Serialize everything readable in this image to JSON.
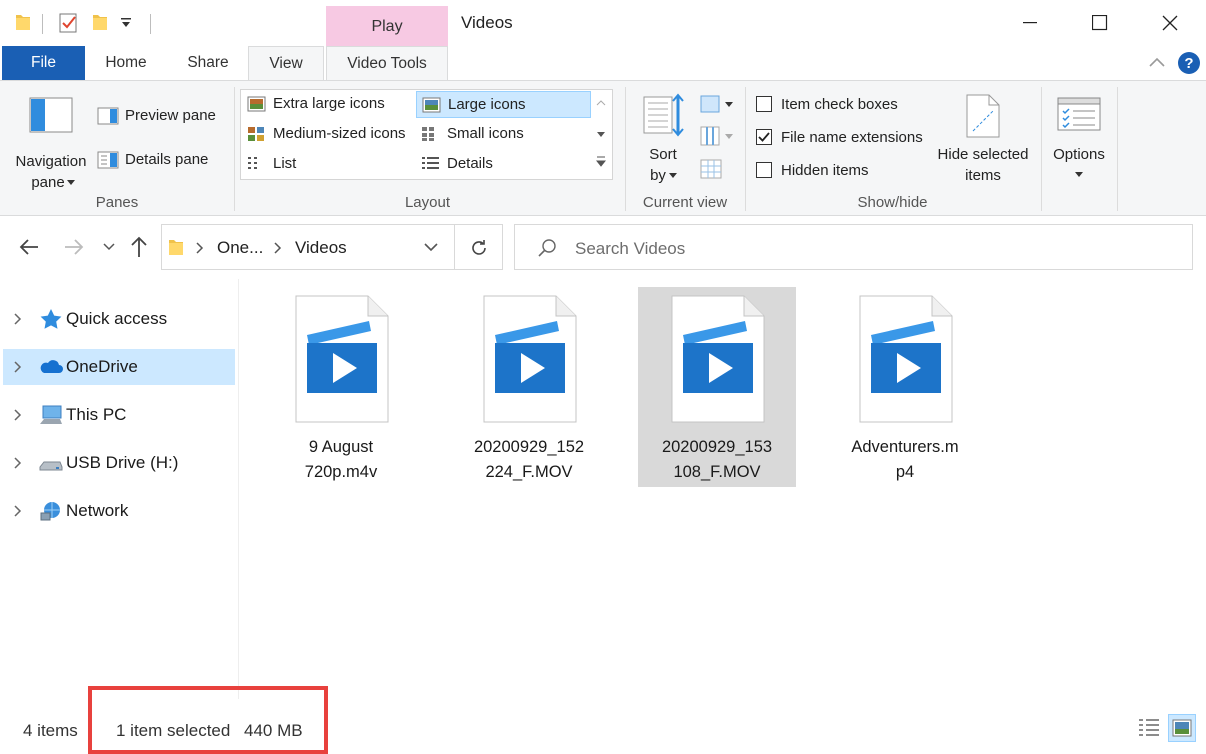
{
  "window": {
    "title": "Videos",
    "contextual_tab": "Play"
  },
  "tabs": {
    "file": "File",
    "home": "Home",
    "share": "Share",
    "view": "View",
    "video_tools": "Video Tools"
  },
  "ribbon": {
    "panes": {
      "label": "Panes",
      "navigation_line1": "Navigation",
      "navigation_line2": "pane",
      "preview": "Preview pane",
      "details": "Details pane"
    },
    "layout": {
      "label": "Layout",
      "items": {
        "extra_large": "Extra large icons",
        "large": "Large icons",
        "medium": "Medium-sized icons",
        "small": "Small icons",
        "list": "List",
        "details": "Details"
      },
      "selected": "Large icons"
    },
    "current_view": {
      "label": "Current view",
      "sort_line1": "Sort",
      "sort_line2": "by"
    },
    "show_hide": {
      "label": "Show/hide",
      "item_check_boxes": "Item check boxes",
      "item_check_boxes_checked": false,
      "file_name_extensions": "File name extensions",
      "file_name_extensions_checked": true,
      "hidden_items": "Hidden items",
      "hidden_items_checked": false,
      "hide_selected_line1": "Hide selected",
      "hide_selected_line2": "items"
    },
    "options": {
      "label": "Options"
    }
  },
  "address": {
    "crumbs": [
      "One...",
      "Videos"
    ],
    "search_placeholder": "Search Videos"
  },
  "nav": {
    "items": [
      {
        "label": "Quick access",
        "icon": "star-icon"
      },
      {
        "label": "OneDrive",
        "icon": "cloud-icon",
        "selected": true
      },
      {
        "label": "This PC",
        "icon": "computer-icon"
      },
      {
        "label": "USB Drive (H:)",
        "icon": "usb-drive-icon"
      },
      {
        "label": "Network",
        "icon": "network-icon"
      }
    ]
  },
  "files": [
    {
      "line1": "9 August",
      "line2": "720p.m4v",
      "selected": false
    },
    {
      "line1": "20200929_152",
      "line2": "224_F.MOV",
      "selected": false
    },
    {
      "line1": "20200929_153",
      "line2": "108_F.MOV",
      "selected": true
    },
    {
      "line1": "Adventurers.m",
      "line2": "p4",
      "selected": false
    }
  ],
  "status": {
    "count": "4 items",
    "selected": "1 item selected",
    "size": "440 MB"
  },
  "colors": {
    "file_tab": "#1a5fb4",
    "context_tab": "#f7c9e3",
    "selection": "#cce8ff",
    "highlight": "#e8413d",
    "video_blue": "#1d74c9"
  }
}
